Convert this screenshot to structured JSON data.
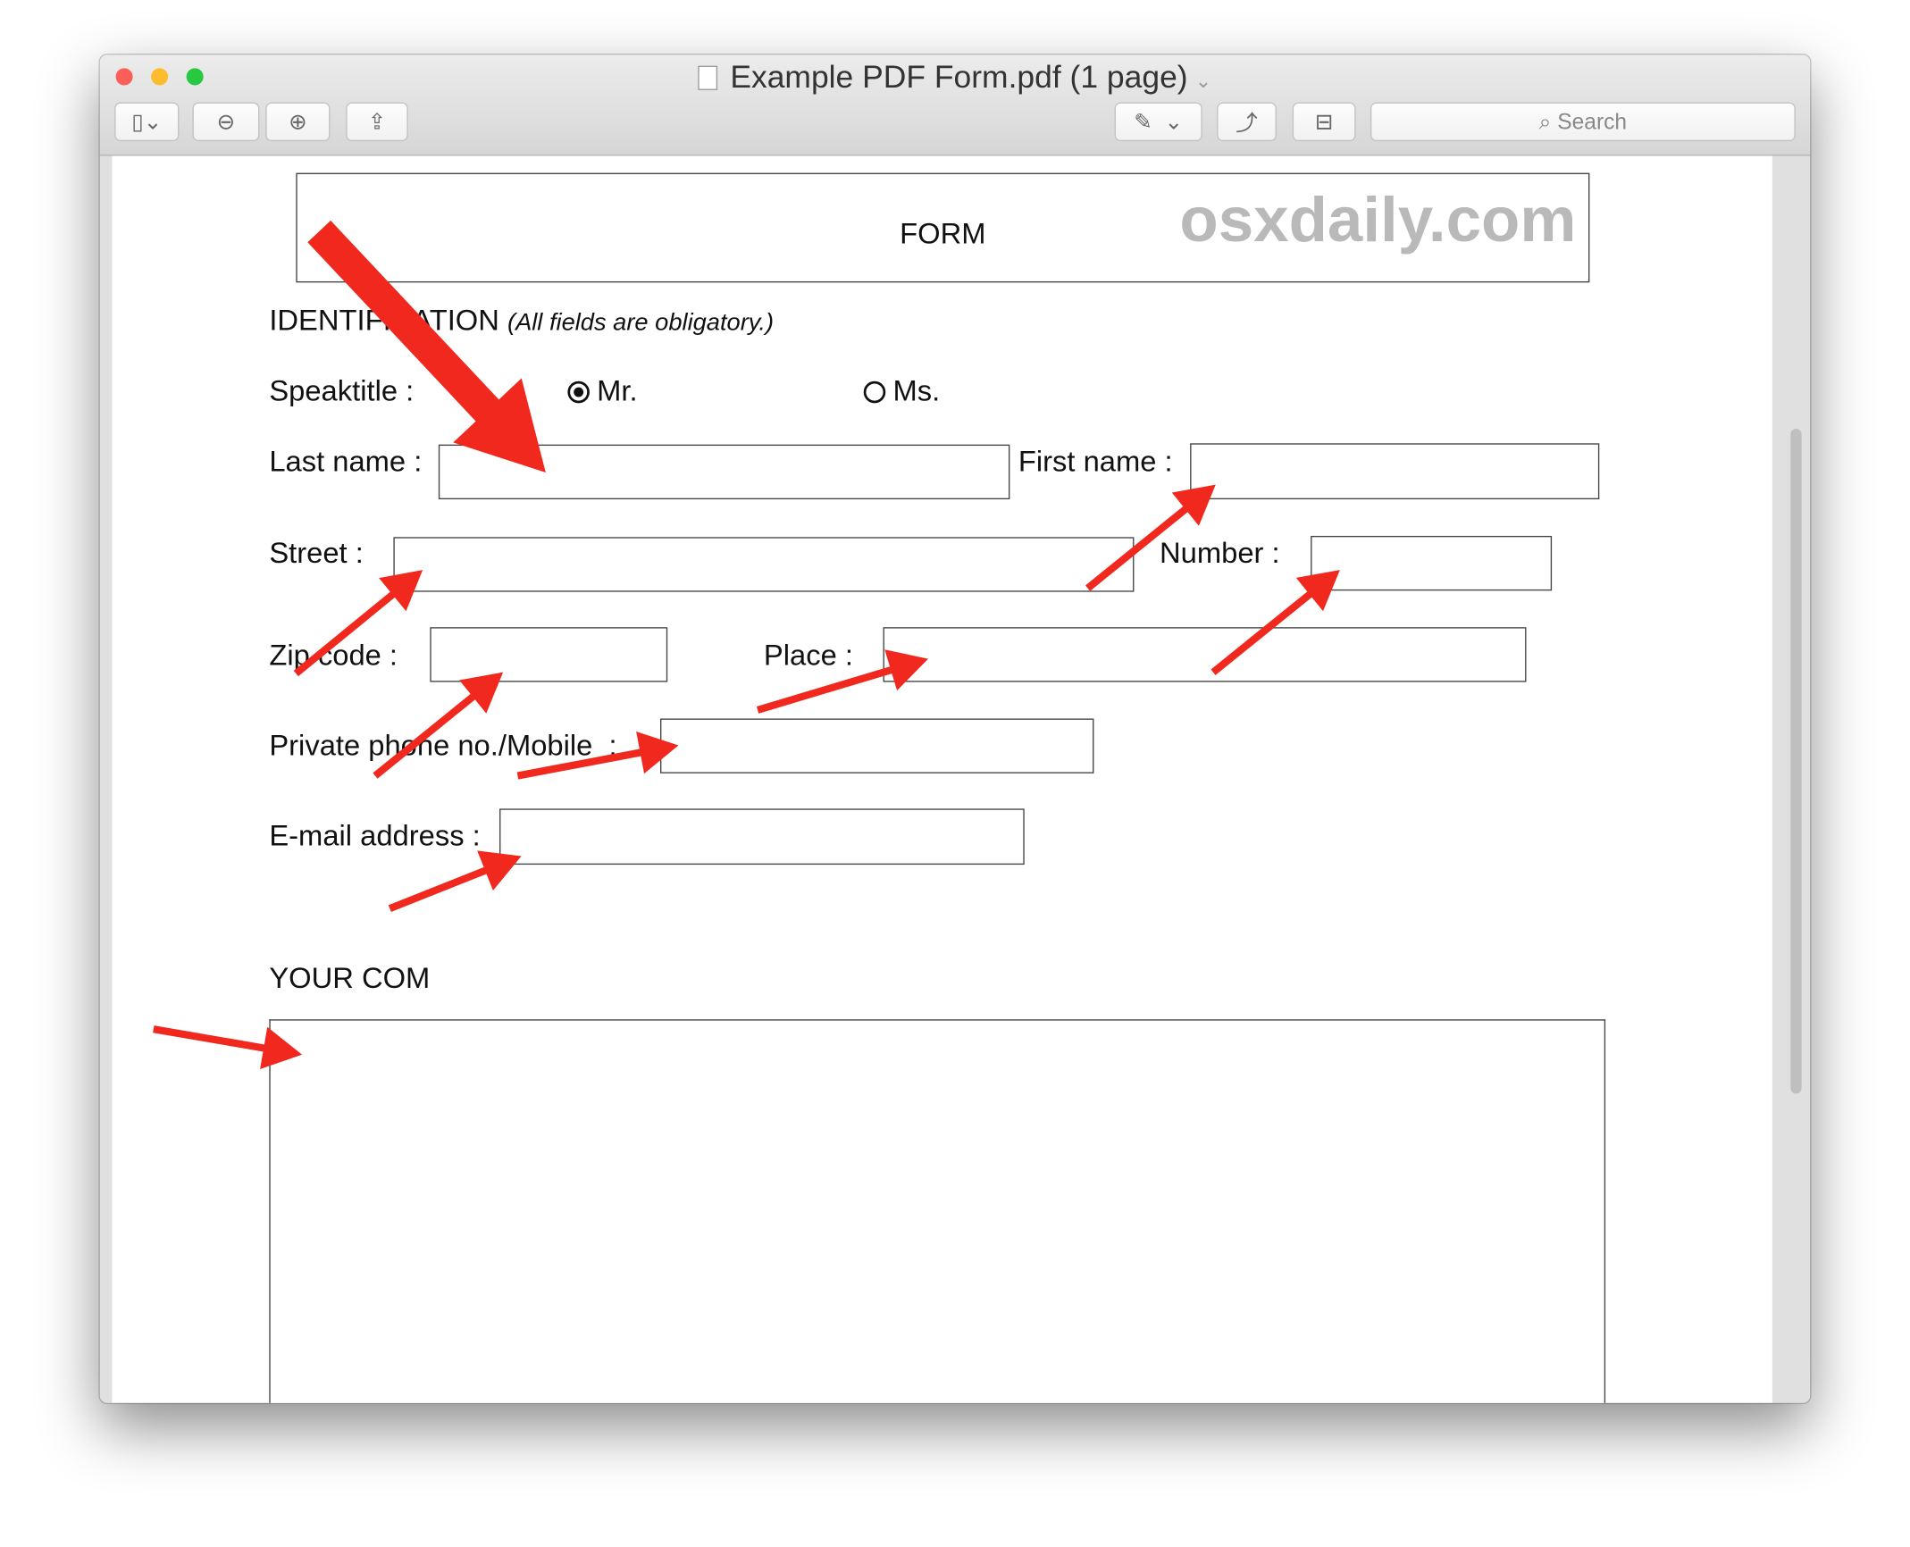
{
  "window": {
    "title": "Example PDF Form.pdf (1 page)"
  },
  "toolbar": {
    "search_placeholder": "Search"
  },
  "form": {
    "header": "FORM",
    "watermark": "osxdaily.com",
    "section_identification": "IDENTIFICATION",
    "section_note": "(All fields are obligatory.)",
    "speaktitle_label": "Speaktitle :",
    "radio_mr": "Mr.",
    "radio_ms": "Ms.",
    "selected_title": "Mr.",
    "last_name_label": "Last name :",
    "first_name_label": "First name :",
    "street_label": "Street :",
    "number_label": "Number :",
    "zip_label": "Zip code :",
    "place_label": "Place :",
    "phone_label": "Private phone no./Mobile  :",
    "email_label": "E-mail address :",
    "comments_label": "YOUR COM"
  },
  "colors": {
    "annotation_arrow": "#f0281e",
    "close": "#fc5f57",
    "minimize": "#fdbc2e",
    "zoom": "#28c840"
  }
}
